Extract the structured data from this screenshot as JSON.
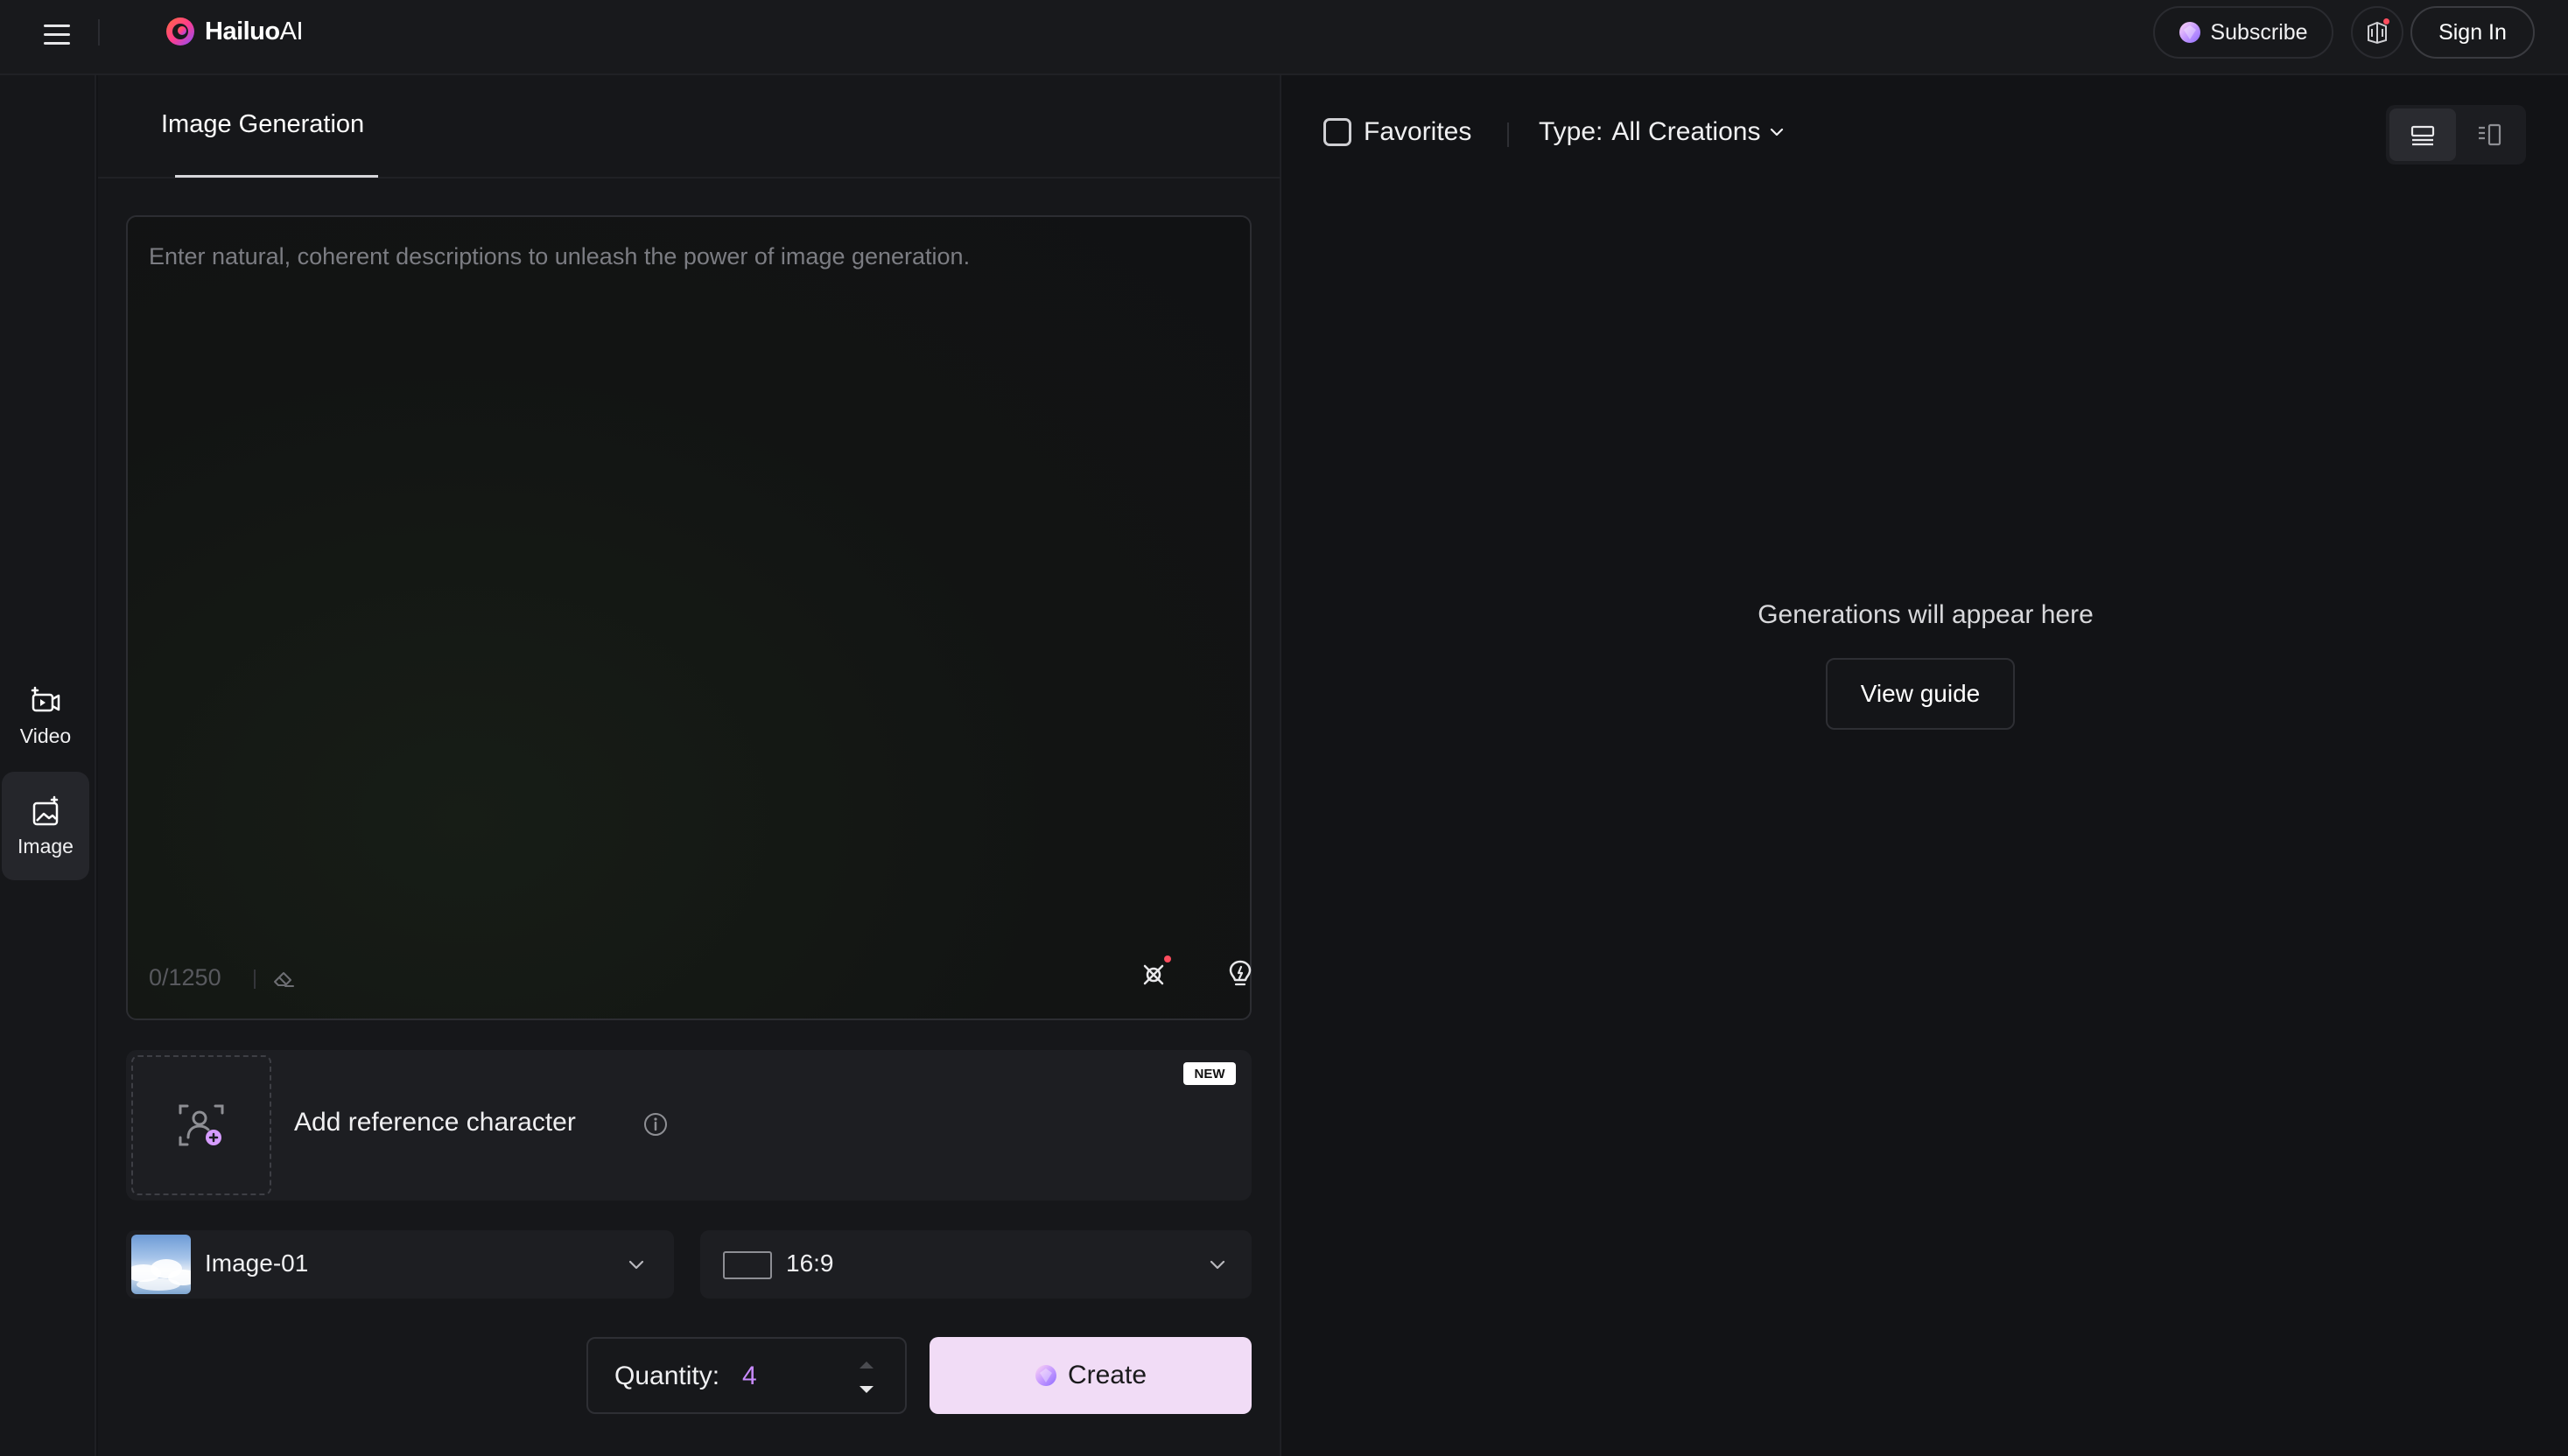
{
  "header": {
    "brand": "Hailuo",
    "brand_suffix": "AI",
    "subscribe_label": "Subscribe",
    "signin_label": "Sign In"
  },
  "left_rail": {
    "items": [
      {
        "label": "Video",
        "icon": "video-icon",
        "active": false
      },
      {
        "label": "Image",
        "icon": "image-icon",
        "active": true
      }
    ]
  },
  "panel": {
    "tabs": [
      {
        "label": "Image Generation",
        "active": true
      }
    ],
    "prompt": {
      "value": "",
      "placeholder": "Enter natural, coherent descriptions to unleash the power of image generation.",
      "counter": "0/1250"
    },
    "tools": [
      "magic-expand-icon",
      "lightbulb-icon",
      "style-brush-icon"
    ],
    "reference": {
      "label": "Add reference character",
      "badge": "NEW"
    },
    "model_select": {
      "value": "Image-01"
    },
    "ratio_select": {
      "value": "16:9"
    },
    "quantity": {
      "label": "Quantity:",
      "value": "4"
    },
    "create_label": "Create"
  },
  "gallery": {
    "favorites_label": "Favorites",
    "type_label": "Type:",
    "type_value": "All Creations",
    "empty_text": "Generations will appear here",
    "guide_label": "View guide"
  },
  "colors": {
    "background": "#121316",
    "panel": "#16171a",
    "create_button": "#f1dcf6",
    "quantity_accent": "#c98bff",
    "notification_dot": "#ff4d5e"
  }
}
